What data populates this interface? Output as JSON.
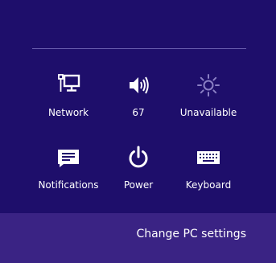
{
  "settings_pane": {
    "tiles": [
      {
        "label": "Network",
        "icon": "network-icon"
      },
      {
        "label": "67",
        "icon": "volume-icon"
      },
      {
        "label": "Unavailable",
        "icon": "brightness-icon"
      },
      {
        "label": "Notifications",
        "icon": "notifications-icon"
      },
      {
        "label": "Power",
        "icon": "power-icon"
      },
      {
        "label": "Keyboard",
        "icon": "keyboard-icon"
      }
    ],
    "footer_link": "Change PC settings"
  },
  "colors": {
    "background": "#1e0e6b",
    "footer_background": "#3a2384",
    "divider": "#6b5fb0",
    "text": "#ffffff",
    "disabled_icon": "#8a7fc4"
  }
}
